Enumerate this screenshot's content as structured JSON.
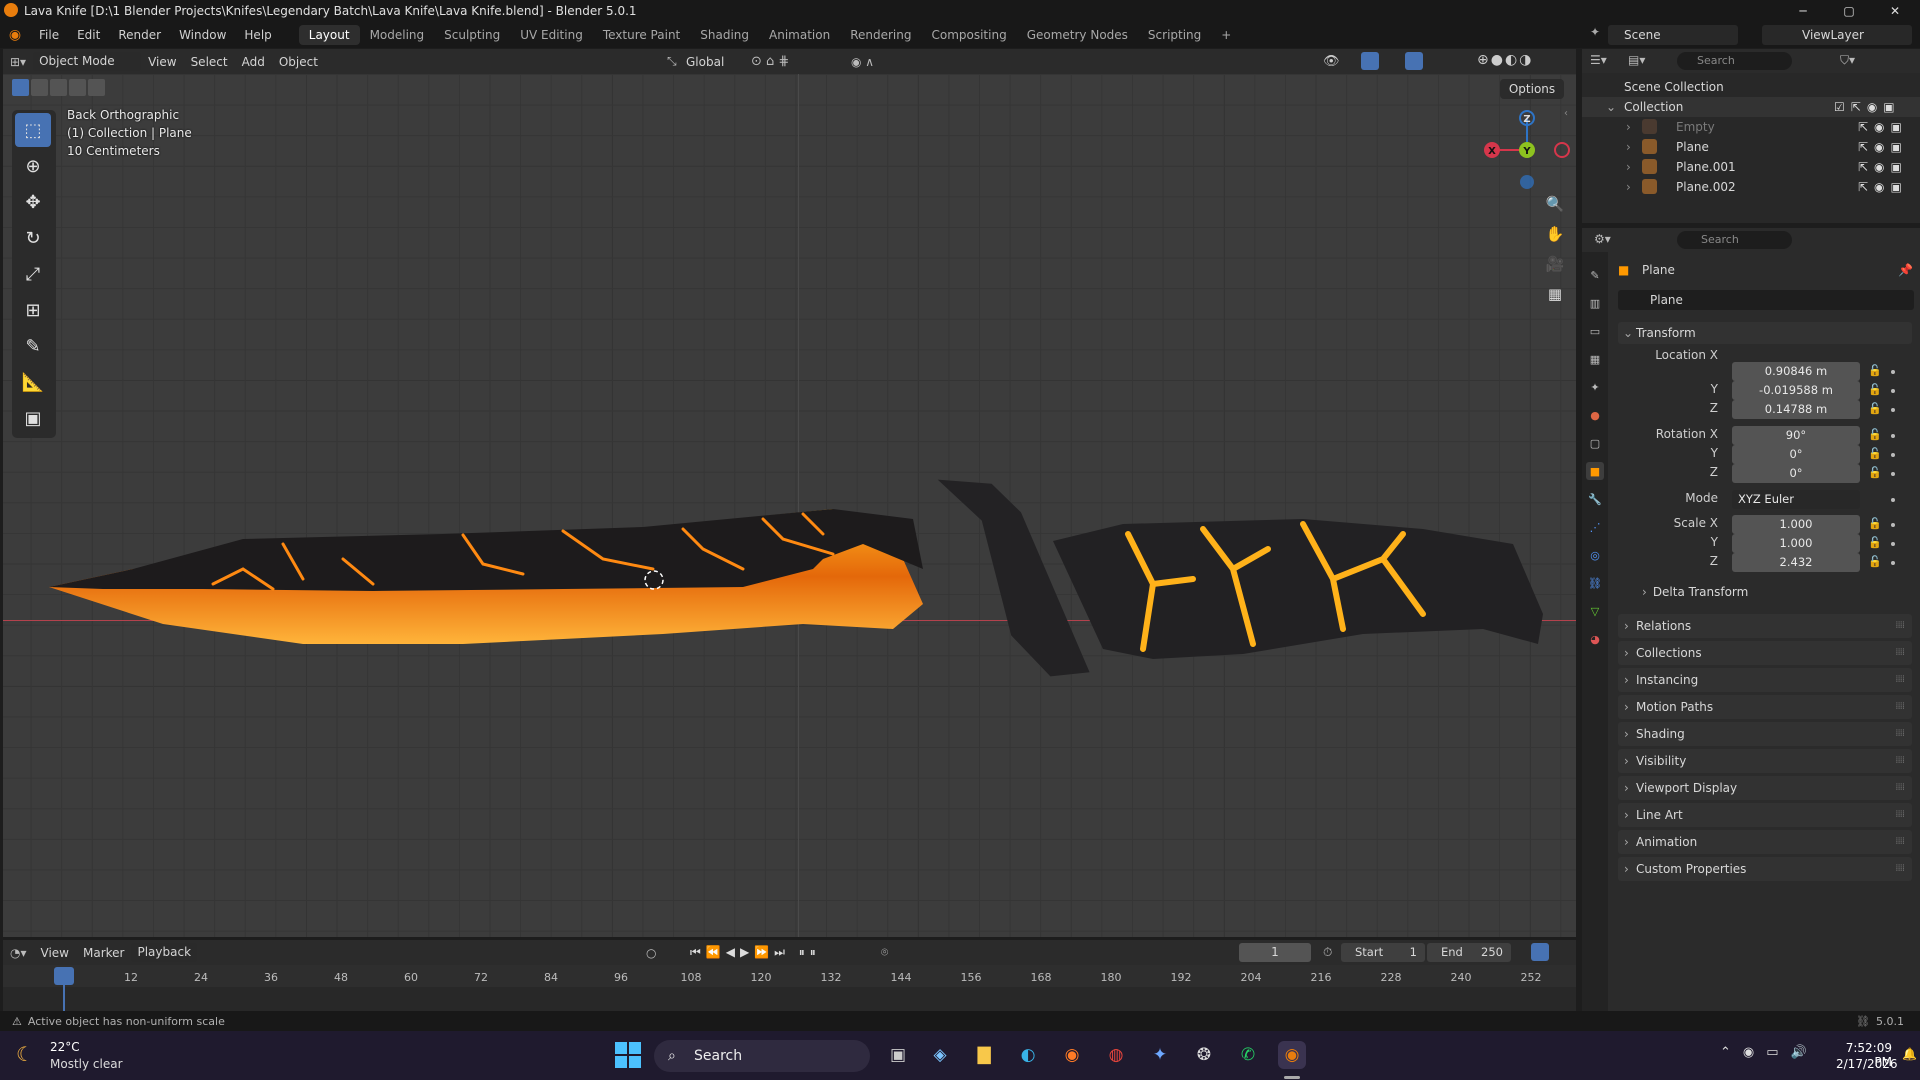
{
  "window": {
    "title": "Lava Knife [D:\\1 Blender Projects\\Knifes\\Legendary Batch\\Lava Knife\\Lava Knife.blend] - Blender 5.0.1",
    "minimize": "─",
    "maximize": "▢",
    "close": "✕"
  },
  "menu": [
    "File",
    "Edit",
    "Render",
    "Window",
    "Help"
  ],
  "workspaces": [
    "Layout",
    "Modeling",
    "Sculpting",
    "UV Editing",
    "Texture Paint",
    "Shading",
    "Animation",
    "Rendering",
    "Compositing",
    "Geometry Nodes",
    "Scripting"
  ],
  "add_workspace": "+",
  "scene": {
    "name": "Scene",
    "viewlayer": "ViewLayer"
  },
  "viewport_header": {
    "mode": "Object Mode",
    "view": "View",
    "select": "Select",
    "add": "Add",
    "object": "Object",
    "orientation": "Global",
    "options": "Options"
  },
  "viewport_overlay": {
    "view_name": "Back Orthographic",
    "collection": "(1) Collection | Plane",
    "scale": "10 Centimeters"
  },
  "gizmo": {
    "x": "X",
    "y": "Y",
    "z": "Z"
  },
  "outliner": {
    "search_placeholder": "Search",
    "root": "Scene Collection",
    "collection": "Collection",
    "items": [
      {
        "name": "Empty",
        "dim": true
      },
      {
        "name": "Plane",
        "dim": false
      },
      {
        "name": "Plane.001",
        "dim": false
      },
      {
        "name": "Plane.002",
        "dim": false
      }
    ]
  },
  "properties": {
    "search_placeholder": "Search",
    "object_name": "Plane",
    "datablock_name": "Plane",
    "transform_title": "Transform",
    "location_label": "Location X",
    "rotation_label": "Rotation X",
    "scale_label": "Scale X",
    "y_label": "Y",
    "z_label": "Z",
    "mode_label": "Mode",
    "location": [
      "0.90846 m",
      "-0.019588 m",
      "0.14788 m"
    ],
    "rotation": [
      "90°",
      "0°",
      "0°"
    ],
    "rotation_mode": "XYZ Euler",
    "scale": [
      "1.000",
      "1.000",
      "2.432"
    ],
    "delta": "Delta Transform",
    "panels": [
      "Relations",
      "Collections",
      "Instancing",
      "Motion Paths",
      "Shading",
      "Visibility",
      "Viewport Display",
      "Line Art",
      "Animation",
      "Custom Properties"
    ]
  },
  "timeline": {
    "view": "View",
    "marker": "Marker",
    "playback": "Playback",
    "current_frame": "1",
    "start_label": "Start",
    "start": "1",
    "end_label": "End",
    "end": "250",
    "ticks": [
      "1",
      "12",
      "24",
      "36",
      "48",
      "60",
      "72",
      "84",
      "96",
      "108",
      "120",
      "132",
      "144",
      "156",
      "168",
      "180",
      "192",
      "204",
      "216",
      "228",
      "240",
      "252"
    ]
  },
  "status": {
    "message": "Active object has non-uniform scale",
    "version": "5.0.1"
  },
  "taskbar": {
    "temperature": "22°C",
    "weather": "Mostly clear",
    "search": "Search",
    "time": "7:52:09 PM",
    "date": "2/17/2026"
  },
  "colors": {
    "accent": "#4772b3",
    "blender_orange": "#e87d0d",
    "x_axis": "#d6364b",
    "y_axis": "#8dc21f",
    "z_axis": "#2e74c6",
    "lava": "#ff8a12"
  }
}
